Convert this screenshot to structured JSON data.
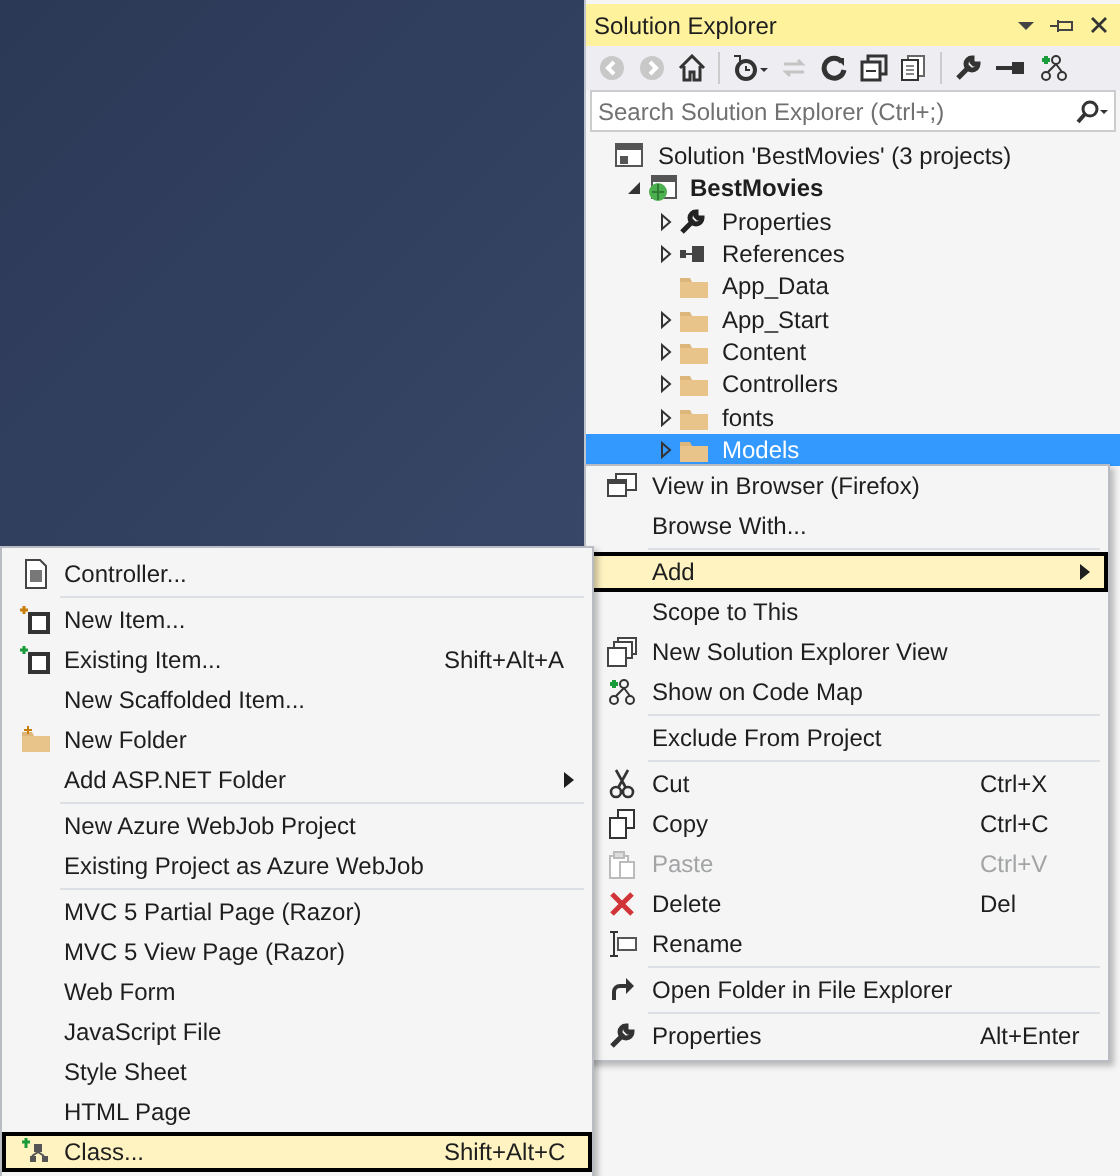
{
  "solution_explorer": {
    "title": "Solution Explorer",
    "search": {
      "placeholder": "Search Solution Explorer (Ctrl+;)"
    },
    "tree": [
      {
        "label": "Solution 'BestMovies' (3 projects)",
        "kind": "solution",
        "selected": false,
        "children": [
          {
            "label": "BestMovies",
            "kind": "project",
            "expanded": true,
            "selected": false,
            "children": [
              {
                "label": "Properties",
                "kind": "properties",
                "expanded": false,
                "selected": false
              },
              {
                "label": "References",
                "kind": "references",
                "expanded": false,
                "selected": false
              },
              {
                "label": "App_Data",
                "kind": "folder",
                "selected": false
              },
              {
                "label": "App_Start",
                "kind": "folder",
                "expanded": false,
                "selected": false
              },
              {
                "label": "Content",
                "kind": "folder",
                "expanded": false,
                "selected": false
              },
              {
                "label": "Controllers",
                "kind": "folder",
                "expanded": false,
                "selected": false
              },
              {
                "label": "fonts",
                "kind": "folder",
                "expanded": false,
                "selected": false
              },
              {
                "label": "Models",
                "kind": "folder",
                "expanded": false,
                "selected": true
              }
            ]
          }
        ]
      }
    ]
  },
  "context_menu": {
    "items": [
      {
        "kind": "item",
        "label": "View in Browser (Firefox)",
        "selected": false,
        "disabled": false,
        "submenu": false
      },
      {
        "kind": "item",
        "label": "Browse With...",
        "selected": false,
        "disabled": false,
        "submenu": false
      },
      {
        "kind": "separator"
      },
      {
        "kind": "item",
        "label": "Add",
        "selected": true,
        "disabled": false,
        "submenu": true
      },
      {
        "kind": "item",
        "label": "Scope to This",
        "selected": false,
        "disabled": false,
        "submenu": false
      },
      {
        "kind": "item",
        "label": "New Solution Explorer View",
        "selected": false,
        "disabled": false,
        "submenu": false
      },
      {
        "kind": "item",
        "label": "Show on Code Map",
        "selected": false,
        "disabled": false,
        "submenu": false
      },
      {
        "kind": "separator"
      },
      {
        "kind": "item",
        "label": "Exclude From Project",
        "selected": false,
        "disabled": false,
        "submenu": false
      },
      {
        "kind": "separator"
      },
      {
        "kind": "item",
        "label": "Cut",
        "shortcut": "Ctrl+X",
        "selected": false,
        "disabled": false,
        "submenu": false
      },
      {
        "kind": "item",
        "label": "Copy",
        "shortcut": "Ctrl+C",
        "selected": false,
        "disabled": false,
        "submenu": false
      },
      {
        "kind": "item",
        "label": "Paste",
        "shortcut": "Ctrl+V",
        "selected": false,
        "disabled": true,
        "submenu": false
      },
      {
        "kind": "item",
        "label": "Delete",
        "shortcut": "Del",
        "selected": false,
        "disabled": false,
        "submenu": false
      },
      {
        "kind": "item",
        "label": "Rename",
        "selected": false,
        "disabled": false,
        "submenu": false
      },
      {
        "kind": "separator"
      },
      {
        "kind": "item",
        "label": "Open Folder in File Explorer",
        "selected": false,
        "disabled": false,
        "submenu": false
      },
      {
        "kind": "separator"
      },
      {
        "kind": "item",
        "label": "Properties",
        "shortcut": "Alt+Enter",
        "selected": false,
        "disabled": false,
        "submenu": false
      }
    ]
  },
  "add_submenu": {
    "items": [
      {
        "kind": "item",
        "label": "Controller...",
        "selected": false,
        "disabled": false,
        "submenu": false
      },
      {
        "kind": "separator"
      },
      {
        "kind": "item",
        "label": "New Item...",
        "selected": false,
        "disabled": false,
        "submenu": false
      },
      {
        "kind": "item",
        "label": "Existing Item...",
        "shortcut": "Shift+Alt+A",
        "selected": false,
        "disabled": false,
        "submenu": false
      },
      {
        "kind": "item",
        "label": "New Scaffolded Item...",
        "selected": false,
        "disabled": false,
        "submenu": false
      },
      {
        "kind": "item",
        "label": "New Folder",
        "selected": false,
        "disabled": false,
        "submenu": false
      },
      {
        "kind": "item",
        "label": "Add ASP.NET Folder",
        "selected": false,
        "disabled": false,
        "submenu": true
      },
      {
        "kind": "separator"
      },
      {
        "kind": "item",
        "label": "New Azure WebJob Project",
        "selected": false,
        "disabled": false,
        "submenu": false
      },
      {
        "kind": "item",
        "label": "Existing Project as Azure WebJob",
        "selected": false,
        "disabled": false,
        "submenu": false
      },
      {
        "kind": "separator"
      },
      {
        "kind": "item",
        "label": "MVC 5 Partial Page (Razor)",
        "selected": false,
        "disabled": false,
        "submenu": false
      },
      {
        "kind": "item",
        "label": "MVC 5 View Page (Razor)",
        "selected": false,
        "disabled": false,
        "submenu": false
      },
      {
        "kind": "item",
        "label": "Web Form",
        "selected": false,
        "disabled": false,
        "submenu": false
      },
      {
        "kind": "item",
        "label": "JavaScript File",
        "selected": false,
        "disabled": false,
        "submenu": false
      },
      {
        "kind": "item",
        "label": "Style Sheet",
        "selected": false,
        "disabled": false,
        "submenu": false
      },
      {
        "kind": "item",
        "label": "HTML Page",
        "selected": false,
        "disabled": false,
        "submenu": false
      },
      {
        "kind": "item",
        "label": "Class...",
        "shortcut": "Shift+Alt+C",
        "selected": true,
        "disabled": false,
        "submenu": false
      }
    ]
  }
}
